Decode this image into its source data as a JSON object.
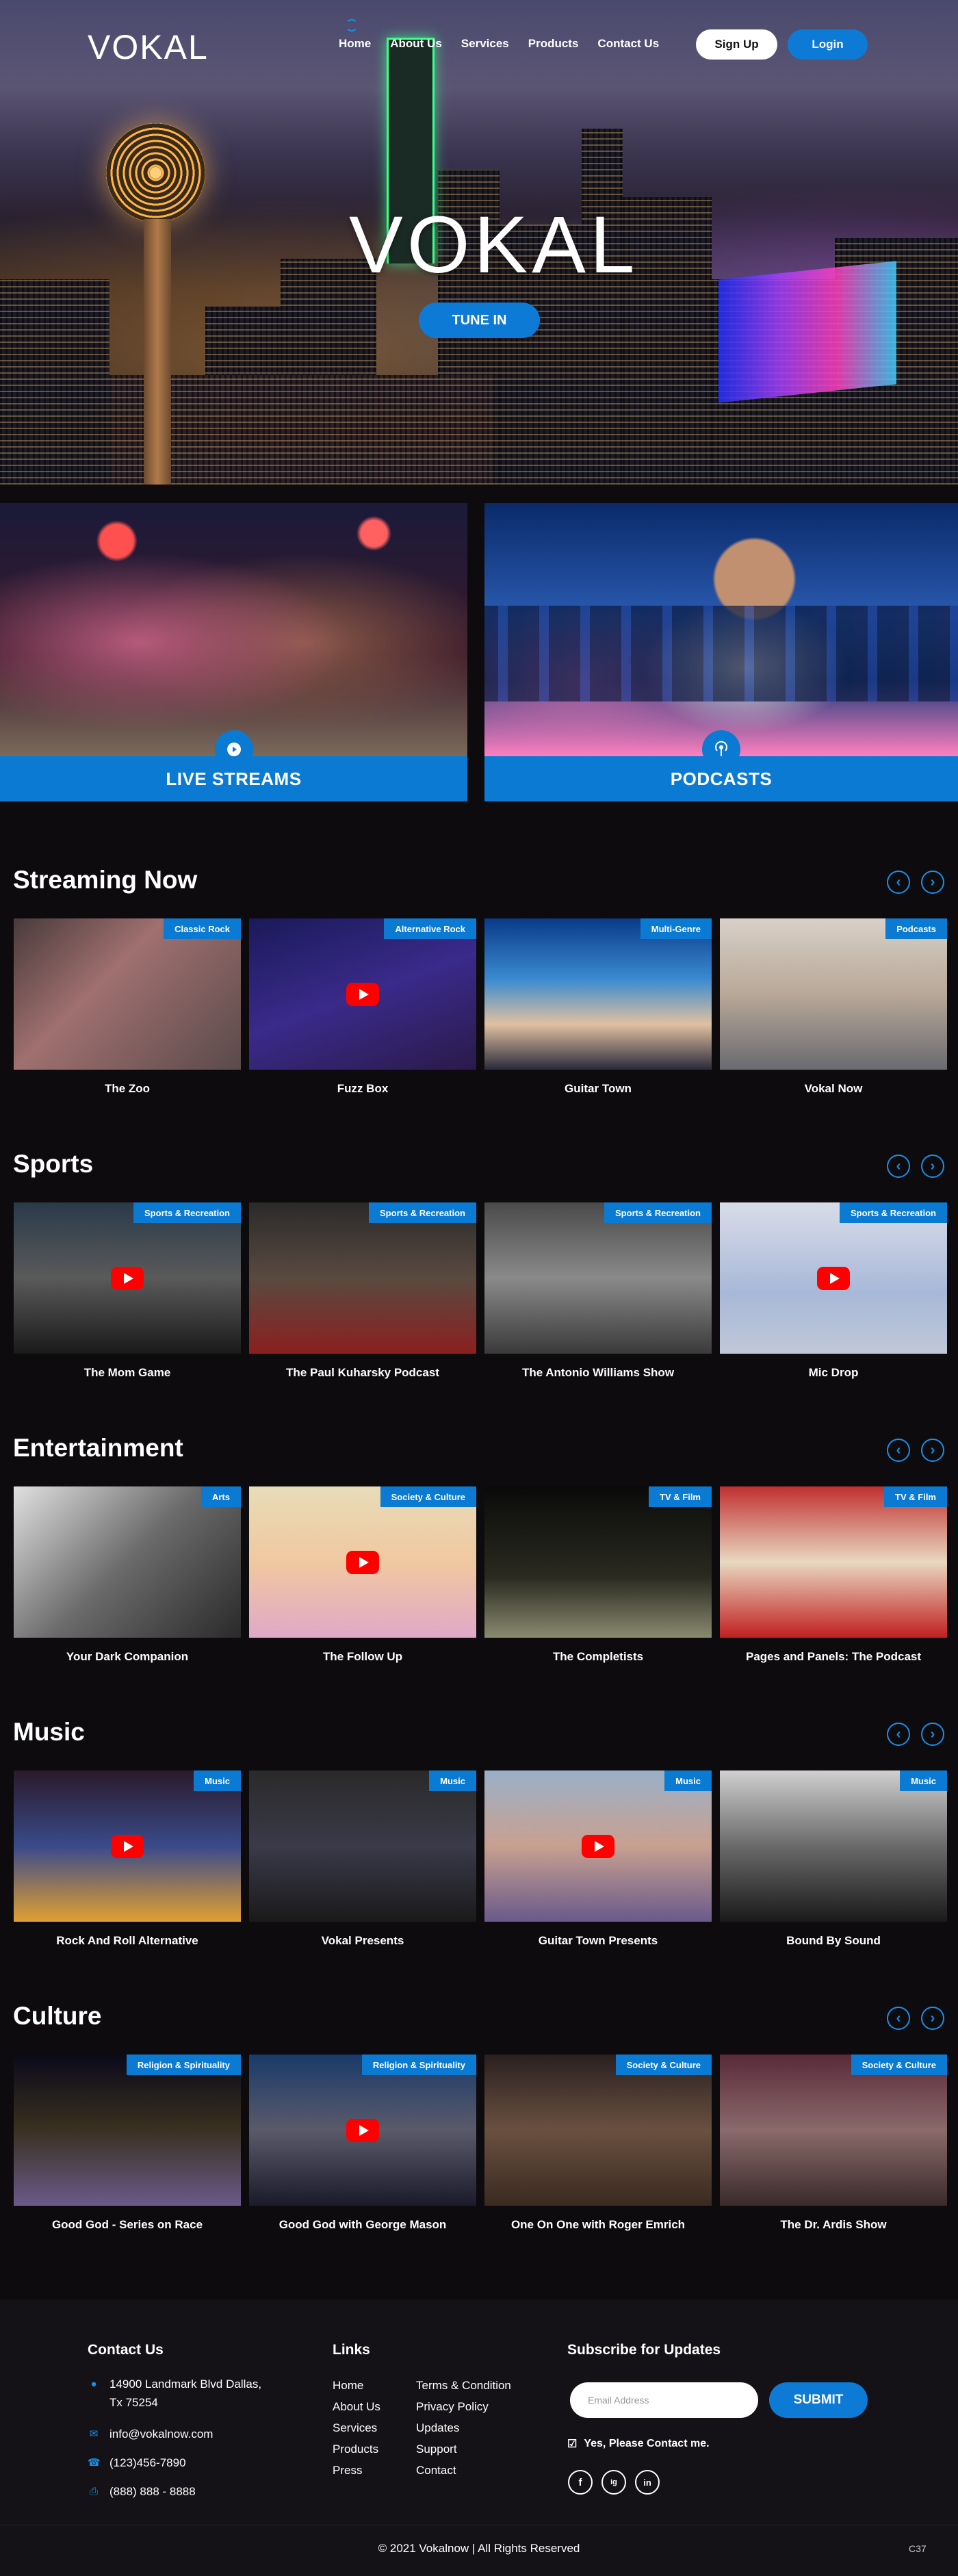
{
  "brand": {
    "logo_small": "VOKAL",
    "hero_logo": "VOKAL"
  },
  "nav": {
    "items": [
      "Home",
      "About Us",
      "Services",
      "Products",
      "Contact Us"
    ],
    "signup": "Sign Up",
    "login": "Login"
  },
  "hero": {
    "tune_in": "TUNE IN"
  },
  "features": {
    "live": "LIVE STREAMS",
    "podcasts": "PODCASTS"
  },
  "sections": [
    {
      "title": "Streaming Now",
      "cards": [
        {
          "tag": "Classic Rock",
          "title": "The Zoo",
          "play": false
        },
        {
          "tag": "Alternative Rock",
          "title": "Fuzz Box",
          "play": true
        },
        {
          "tag": "Multi-Genre",
          "title": "Guitar Town",
          "play": false
        },
        {
          "tag": "Podcasts",
          "title": "Vokal Now",
          "play": false
        }
      ]
    },
    {
      "title": "Sports",
      "cards": [
        {
          "tag": "Sports & Recreation",
          "title": "The Mom Game",
          "play": true
        },
        {
          "tag": "Sports & Recreation",
          "title": "The Paul Kuharsky Podcast",
          "play": false
        },
        {
          "tag": "Sports & Recreation",
          "title": "The Antonio Williams Show",
          "play": false
        },
        {
          "tag": "Sports & Recreation",
          "title": "Mic Drop",
          "play": true
        }
      ]
    },
    {
      "title": "Entertainment",
      "cards": [
        {
          "tag": "Arts",
          "title": "Your Dark Companion",
          "play": false
        },
        {
          "tag": "Society & Culture",
          "title": "The Follow Up",
          "play": true
        },
        {
          "tag": "TV & Film",
          "title": "The Completists",
          "play": false
        },
        {
          "tag": "TV & Film",
          "title": "Pages and Panels: The Podcast",
          "play": false
        }
      ]
    },
    {
      "title": "Music",
      "cards": [
        {
          "tag": "Music",
          "title": "Rock And Roll Alternative",
          "play": true
        },
        {
          "tag": "Music",
          "title": "Vokal Presents",
          "play": false
        },
        {
          "tag": "Music",
          "title": "Guitar Town Presents",
          "play": true
        },
        {
          "tag": "Music",
          "title": "Bound By Sound",
          "play": false
        }
      ]
    },
    {
      "title": "Culture",
      "cards": [
        {
          "tag": "Religion & Spirituality",
          "title": "Good God - Series on Race",
          "play": false
        },
        {
          "tag": "Religion & Spirituality",
          "title": "Good God with George Mason",
          "play": true
        },
        {
          "tag": "Society & Culture",
          "title": "One On One with Roger Emrich",
          "play": false
        },
        {
          "tag": "Society & Culture",
          "title": "The Dr. Ardis Show",
          "play": false
        }
      ]
    }
  ],
  "footer": {
    "contact_title": "Contact Us",
    "address_line1": "14900 Landmark Blvd Dallas,",
    "address_line2": "Tx 75254",
    "email": "info@vokalnow.com",
    "phone": "(123)456-7890",
    "fax": "(888)  888 - 8888",
    "links_title": "Links",
    "links_col1": [
      "Home",
      "About Us",
      "Services",
      "Products",
      "Press"
    ],
    "links_col2": [
      "Terms & Condition",
      "Privacy Policy",
      "Updates",
      "Support",
      "Contact"
    ],
    "subscribe_title": "Subscribe for Updates",
    "email_placeholder": "Email Address",
    "submit": "SUBMIT",
    "consent": "Yes, Please Contact me.",
    "social": [
      "f",
      "ig",
      "in"
    ],
    "copyright": "© 2021 Vokalnow  |  All Rights Reserved",
    "corner_id": "C37"
  },
  "colors": {
    "accent": "#0a7ad2",
    "background": "#0d0b0e",
    "footer": "#141216"
  }
}
